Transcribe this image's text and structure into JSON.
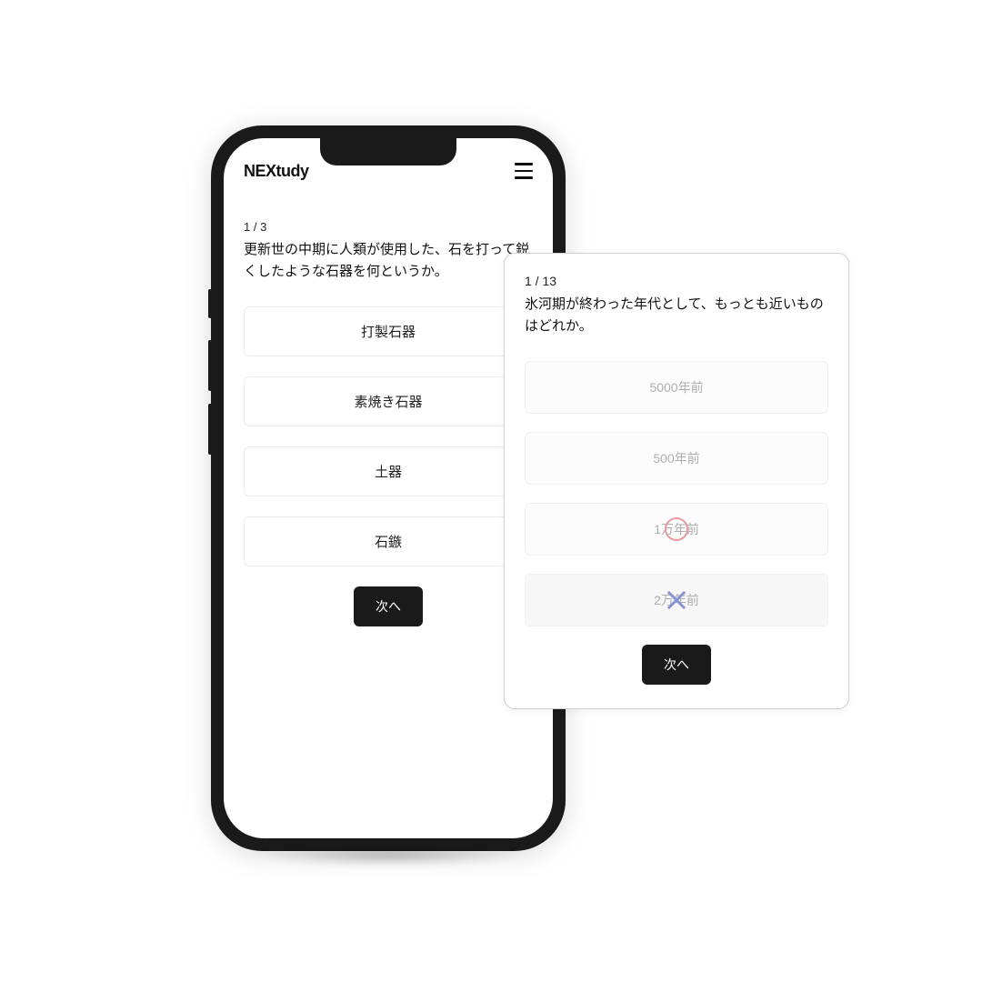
{
  "app": {
    "logo": "NEXtudy"
  },
  "quiz1": {
    "progress": "1 / 3",
    "question": "更新世の中期に人類が使用した、石を打って鋭くしたような石器を何というか。",
    "options": [
      "打製石器",
      "素焼き石器",
      "土器",
      "石鏃"
    ],
    "next_label": "次へ"
  },
  "quiz2": {
    "progress": "1 / 13",
    "question": "氷河期が終わった年代として、もっとも近いものはどれか。",
    "options": [
      "5000年前",
      "500年前",
      "1万年前",
      "2万年前"
    ],
    "next_label": "次へ"
  }
}
